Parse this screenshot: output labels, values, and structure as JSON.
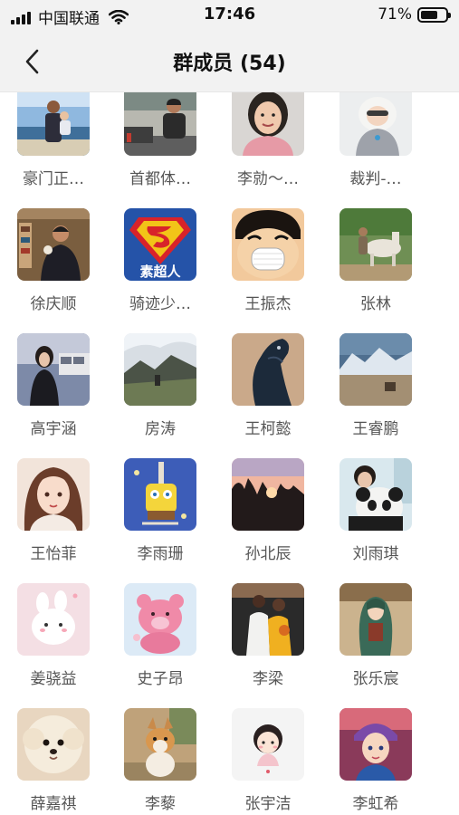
{
  "status_bar": {
    "carrier": "中国联通",
    "time": "17:46",
    "battery": "71%",
    "battery_level": 0.71
  },
  "header": {
    "title": "群成员 (54)"
  },
  "members": [
    {
      "name": "豪门正…",
      "avatar": "beach-family-photo"
    },
    {
      "name": "首都体…",
      "avatar": "man-seated-photo"
    },
    {
      "name": "李勍～…",
      "avatar": "woman-smiling-photo"
    },
    {
      "name": "裁判-…",
      "avatar": "child-in-hood-photo"
    },
    {
      "name": "徐庆顺",
      "avatar": "man-in-shop-photo"
    },
    {
      "name": "骑迹少…",
      "avatar": "superman-logo"
    },
    {
      "name": "王振杰",
      "avatar": "cartoon-laughing-boy"
    },
    {
      "name": "张林",
      "avatar": "person-with-horse-photo"
    },
    {
      "name": "高宇涵",
      "avatar": "girl-street-photo"
    },
    {
      "name": "房涛",
      "avatar": "mountain-landscape-photo"
    },
    {
      "name": "王柯懿",
      "avatar": "black-horse-photo"
    },
    {
      "name": "王睿鹏",
      "avatar": "snowy-mountains-photo"
    },
    {
      "name": "王怡菲",
      "avatar": "anime-girl-drawing"
    },
    {
      "name": "李雨珊",
      "avatar": "sponge-cartoon"
    },
    {
      "name": "孙北辰",
      "avatar": "sunset-trees-photo"
    },
    {
      "name": "刘雨琪",
      "avatar": "girl-with-panda-photo"
    },
    {
      "name": "姜骁益",
      "avatar": "white-bunny-sticker"
    },
    {
      "name": "史子昂",
      "avatar": "pink-bear-sticker"
    },
    {
      "name": "李梁",
      "avatar": "basketball-players-photo"
    },
    {
      "name": "张乐宸",
      "avatar": "game-character-art"
    },
    {
      "name": "薛嘉祺",
      "avatar": "fluffy-dog-photo"
    },
    {
      "name": "李藜",
      "avatar": "corgi-dog-photo"
    },
    {
      "name": "张宇洁",
      "avatar": "cartoon-girl-sticker"
    },
    {
      "name": "李虹希",
      "avatar": "painted-girl-art"
    }
  ]
}
